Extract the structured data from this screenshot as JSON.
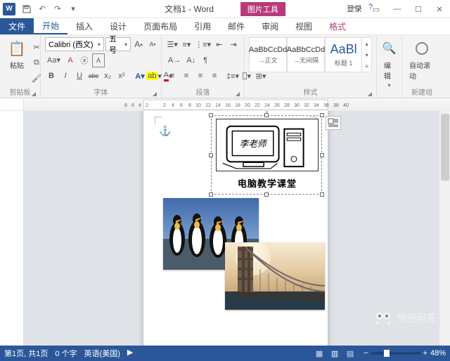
{
  "titlebar": {
    "app_icon_text": "W",
    "doc_title": "文档1 - Word",
    "context_tab_group": "图片工具",
    "login": "登录"
  },
  "tabs": {
    "file": "文件",
    "home": "开始",
    "insert": "插入",
    "design": "设计",
    "layout": "页面布局",
    "references": "引用",
    "mailings": "邮件",
    "review": "审阅",
    "view": "视图",
    "format": "格式"
  },
  "ribbon": {
    "clipboard": {
      "paste": "粘贴",
      "label": "剪贴板"
    },
    "font": {
      "name": "Calibri (西文)",
      "size": "五号",
      "label": "字体",
      "buttons": {
        "bold": "B",
        "italic": "I",
        "underline": "U",
        "strike": "abc",
        "sub": "x₂",
        "sup": "x²",
        "grow": "A",
        "shrink": "A",
        "clear": "A",
        "color": "A",
        "highlight": "ab"
      }
    },
    "paragraph": {
      "label": "段落"
    },
    "styles": {
      "label": "样式",
      "items": [
        {
          "preview": "AaBbCcDd",
          "name": "→正文"
        },
        {
          "preview": "AaBbCcDd",
          "name": "→无间隔"
        },
        {
          "preview": "AaBl",
          "name": "标题 1"
        }
      ]
    },
    "editing": {
      "find": "编辑"
    },
    "newgroup": {
      "autoscroll": "自动滚动",
      "label": "新建组"
    }
  },
  "document": {
    "caption": "电脑教学课堂",
    "clipart_text": "李老师"
  },
  "statusbar": {
    "page": "第1页, 共1页",
    "words": "0 个字",
    "lang": "英语(美国)",
    "zoom": "48%"
  },
  "watermark": "悟空问答",
  "colors": {
    "brand": "#2b579a",
    "context": "#b73a7a"
  }
}
